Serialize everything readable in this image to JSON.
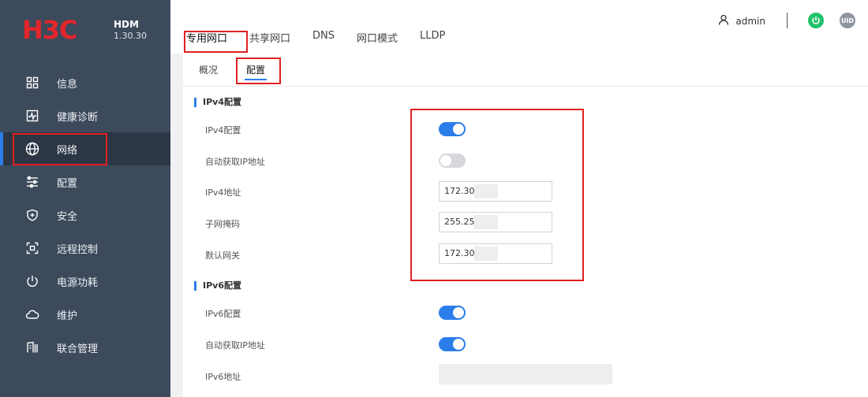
{
  "brand": {
    "logo": "H3C",
    "name": "HDM",
    "version": "1.30.30"
  },
  "sidebar": {
    "items": [
      {
        "label": "信息",
        "icon": "grid-icon"
      },
      {
        "label": "健康诊断",
        "icon": "pulse-icon"
      },
      {
        "label": "网络",
        "icon": "globe-icon",
        "active": true
      },
      {
        "label": "配置",
        "icon": "sliders-icon"
      },
      {
        "label": "安全",
        "icon": "shield-plus-icon"
      },
      {
        "label": "远程控制",
        "icon": "remote-icon"
      },
      {
        "label": "电源功耗",
        "icon": "power-icon"
      },
      {
        "label": "维护",
        "icon": "cloud-icon"
      },
      {
        "label": "联合管理",
        "icon": "building-icon"
      }
    ]
  },
  "header": {
    "tabs": [
      "专用网口",
      "共享网口",
      "DNS",
      "网口模式",
      "LLDP"
    ],
    "user": "admin",
    "uid_label": "UID"
  },
  "subtabs": [
    "概况",
    "配置"
  ],
  "ipv4": {
    "title": "IPv4配置",
    "enable_label": "IPv4配置",
    "enable": true,
    "dhcp_label": "自动获取IP地址",
    "dhcp": false,
    "address_label": "IPv4地址",
    "address": "172.30",
    "mask_label": "子网掩码",
    "mask": "255.25",
    "gateway_label": "默认网关",
    "gateway": "172.30"
  },
  "ipv6": {
    "title": "IPv6配置",
    "enable_label": "IPv6配置",
    "enable": true,
    "dhcp_label": "自动获取IP地址",
    "dhcp": true,
    "address_label": "IPv6地址",
    "address": ""
  },
  "colors": {
    "sidebar": "#3d4a5c",
    "accent": "#2b7de9",
    "highlight": "#e02020",
    "logo": "#e3262b",
    "power": "#1ec26a"
  }
}
